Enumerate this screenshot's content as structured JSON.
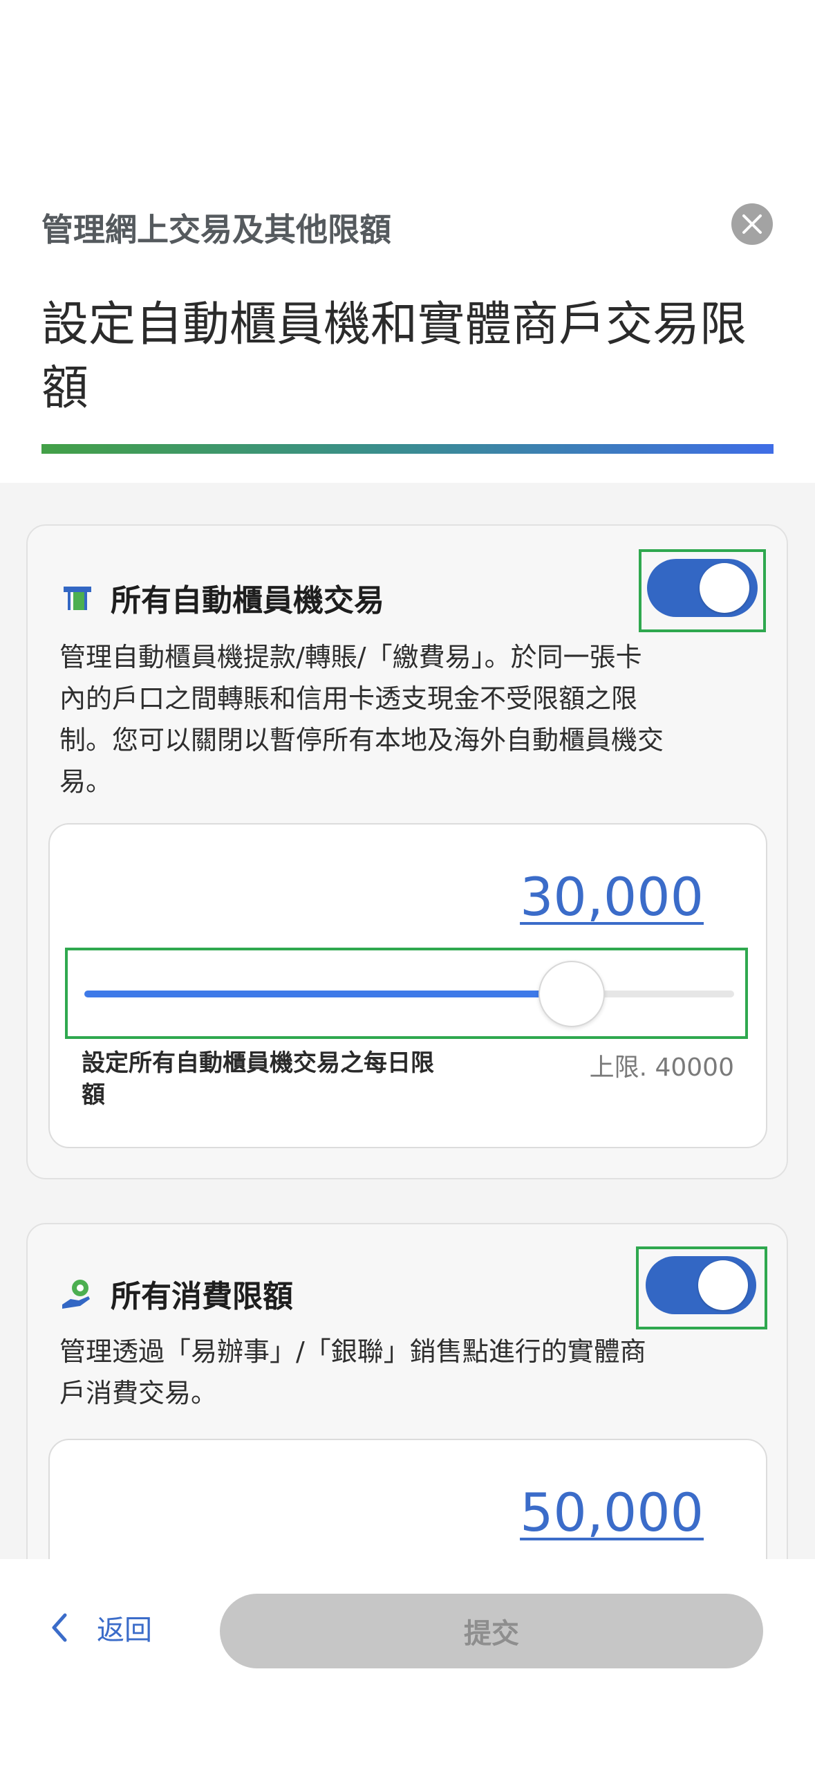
{
  "header": {
    "subtitle": "管理網上交易及其他限額",
    "title": "設定自動櫃員機和實體商戶交易限額",
    "close_icon": "close-icon"
  },
  "atm_card": {
    "icon": "atm-icon",
    "title": "所有自動櫃員機交易",
    "toggle_on": true,
    "description": "管理自動櫃員機提款/轉賬/「繳費易」。於同一張卡內的戶口之間轉賬和信用卡透支現金不受限額之限制。您可以關閉以暫停所有本地及海外自動櫃員機交易。",
    "limit_value": "30,000",
    "slider": {
      "value": 30000,
      "max": 40000
    },
    "slider_label": "設定所有自動櫃員機交易之每日限額",
    "max_label": "上限. 40000"
  },
  "spending_card": {
    "icon": "hand-coin-icon",
    "title": "所有消費限額",
    "toggle_on": true,
    "description": "管理透過「易辦事」/「銀聯」銷售點進行的實體商戶消費交易。",
    "limit_value": "50,000"
  },
  "footer": {
    "back_icon": "chevron-left-icon",
    "back_label": "返回",
    "submit_label": "提交"
  },
  "colors": {
    "accent_blue": "#3367c4",
    "link_blue": "#3b6cc9",
    "highlight_green": "#2fa84f",
    "slider_fill": "#3e7ae8",
    "disabled_button": "#c6c6c6"
  }
}
